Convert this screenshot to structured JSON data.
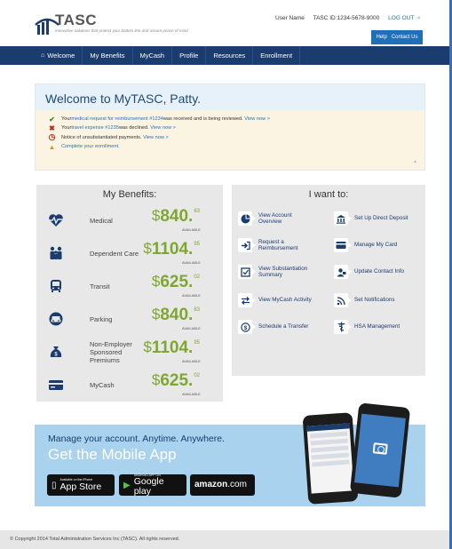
{
  "header": {
    "logo_text": "TASC",
    "tagline": "Innovative solutions that protect your bottom line and assure peace of mind",
    "username": "User Name",
    "tasc_id": "TASC ID:1234-5678-9000",
    "logout": "LOG OUT",
    "help": "Help",
    "contact": "Contact Us"
  },
  "nav": {
    "items": [
      {
        "label": "Welcome",
        "icon": "home-icon"
      },
      {
        "label": "My Benefits"
      },
      {
        "label": "MyCash"
      },
      {
        "label": "Profile"
      },
      {
        "label": "Resources"
      },
      {
        "label": "Enrollment"
      }
    ]
  },
  "welcome": {
    "title": "Welcome to MyTASC, Patty.",
    "notices": [
      {
        "icon": "check-icon",
        "pre": "Your ",
        "link": "medical request for reimbursement #1234",
        "post": " was received and is being reviewed.",
        "action": "View now >"
      },
      {
        "icon": "x-icon",
        "pre": "Your ",
        "link": "travel expense #1235",
        "post": " was declined.",
        "action": "View now >"
      },
      {
        "icon": "clock-icon",
        "pre": "Notice of unsubstantiated payments.",
        "link": "",
        "post": "",
        "action": "View now >"
      },
      {
        "icon": "warning-icon",
        "pre": "",
        "link": "Complete your enrollment.",
        "post": "",
        "action": ""
      }
    ]
  },
  "benefits": {
    "title": "My Benefits:",
    "available_label": "AVAILABLE",
    "items": [
      {
        "label": "Medical",
        "icon": "heartbeat-icon",
        "dollar": "$",
        "whole": "840.",
        "cents": "83"
      },
      {
        "label": "Dependent Care",
        "icon": "family-icon",
        "dollar": "$",
        "whole": "1104.",
        "cents": "95"
      },
      {
        "label": "Transit",
        "icon": "bus-icon",
        "dollar": "$",
        "whole": "625.",
        "cents": "02"
      },
      {
        "label": "Parking",
        "icon": "car-icon",
        "dollar": "$",
        "whole": "840.",
        "cents": "83"
      },
      {
        "label": "Non-Employer Sponsored Premiums",
        "icon": "moneybag-icon",
        "dollar": "$",
        "whole": "1104.",
        "cents": "95"
      },
      {
        "label": "MyCash",
        "icon": "card-icon",
        "dollar": "$",
        "whole": "625.",
        "cents": "02"
      }
    ]
  },
  "want": {
    "title": "I want to:",
    "actions": [
      {
        "label": "View Account Overview",
        "icon": "pie-chart-icon"
      },
      {
        "label": "Set Up Direct Deposit",
        "icon": "bank-icon"
      },
      {
        "label": "Request a Reimbursement",
        "icon": "login-arrow-icon"
      },
      {
        "label": "Manage My Card",
        "icon": "card-icon"
      },
      {
        "label": "View Substantiation Summary",
        "icon": "checklist-icon"
      },
      {
        "label": "Update Contact Info",
        "icon": "contact-icon"
      },
      {
        "label": "View MyCash Activity",
        "icon": "transfer-arrows-icon"
      },
      {
        "label": "Set Notifications",
        "icon": "signal-icon"
      },
      {
        "label": "Schedule a Transfer",
        "icon": "dollar-circle-icon"
      },
      {
        "label": "HSA Management",
        "icon": "caduceus-icon"
      }
    ]
  },
  "mobile": {
    "line1": "Manage your account. Anytime. Anywhere.",
    "line2": "Get the Mobile App",
    "appstore_small": "Available on the iPhone",
    "appstore_big": "App Store",
    "google_small": "ANDROID APP ON",
    "google_big": "Google play",
    "amazon": "amazon",
    "amazon_suffix": ".com"
  },
  "footer": {
    "text": "© Copyright 2014 Total Administration Services Inc (TASC). All rights reserved."
  },
  "colors": {
    "navy": "#1a3c6e",
    "blue": "#1f70b6",
    "green": "#7fa72f",
    "panel": "#e8e8e8",
    "notice_bg": "#fcf4e3",
    "mobile_bg": "#a9d2ee"
  }
}
